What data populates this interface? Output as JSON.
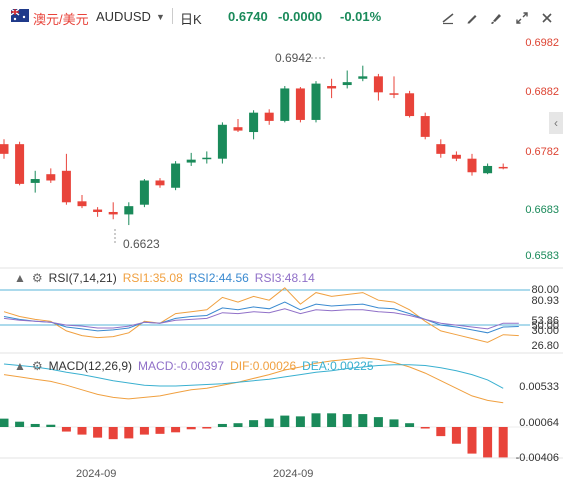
{
  "header": {
    "symbol_cn": "澳元/美元",
    "symbol_en": "AUDUSD",
    "timeframe": "日K",
    "price": "0.6740",
    "change": "-0.0000",
    "change_pct": "-0.01%",
    "up_color": "#1a8a5a",
    "down_color": "#e8433a"
  },
  "toolbar_icons": [
    "draw-line-icon",
    "pencil-icon",
    "brush-icon",
    "fullscreen-icon",
    "close-icon"
  ],
  "price_axis": [
    "0.6982",
    "0.6882",
    "0.6782",
    "0.6683",
    "0.6583"
  ],
  "annotations": {
    "high": "0.6942",
    "low": "0.6623"
  },
  "rsi": {
    "title": "RSI(7,14,21)",
    "rsi1": "RSI1:35.08",
    "rsi2": "RSI2:44.56",
    "rsi3": "RSI3:48.14",
    "axis": [
      "80.00",
      "80.93",
      "53.86",
      "50.00",
      "30.00",
      "26.80"
    ],
    "colors": {
      "rsi1": "#f0a040",
      "rsi2": "#3a8ad0",
      "rsi3": "#9070c8"
    }
  },
  "macd": {
    "title": "MACD(12,26,9)",
    "macd": "MACD:-0.00397",
    "dif": "DIF:0.00026",
    "dea": "DEA:0.00225",
    "axis": [
      "0.00533",
      "0.00064",
      "-0.00406"
    ],
    "colors": {
      "dif": "#f0a040",
      "dea": "#3ab0d0"
    }
  },
  "x_axis": [
    "2024-09",
    "2024-09"
  ],
  "chart_data": {
    "type": "candlestick",
    "ylim": [
      0.6555,
      0.7005
    ],
    "candles": [
      {
        "o": 0.679,
        "c": 0.677,
        "h": 0.68,
        "l": 0.676
      },
      {
        "o": 0.679,
        "c": 0.6708,
        "h": 0.6795,
        "l": 0.6705
      },
      {
        "o": 0.671,
        "c": 0.6718,
        "h": 0.6735,
        "l": 0.669
      },
      {
        "o": 0.6728,
        "c": 0.6715,
        "h": 0.674,
        "l": 0.671
      },
      {
        "o": 0.6735,
        "c": 0.667,
        "h": 0.677,
        "l": 0.6665
      },
      {
        "o": 0.6672,
        "c": 0.6662,
        "h": 0.6685,
        "l": 0.6658
      },
      {
        "o": 0.6655,
        "c": 0.665,
        "h": 0.666,
        "l": 0.664
      },
      {
        "o": 0.665,
        "c": 0.6645,
        "h": 0.667,
        "l": 0.6635
      },
      {
        "o": 0.6645,
        "c": 0.6662,
        "h": 0.667,
        "l": 0.6623
      },
      {
        "o": 0.6665,
        "c": 0.6715,
        "h": 0.6718,
        "l": 0.666
      },
      {
        "o": 0.6715,
        "c": 0.6705,
        "h": 0.672,
        "l": 0.67
      },
      {
        "o": 0.67,
        "c": 0.675,
        "h": 0.6755,
        "l": 0.6695
      },
      {
        "o": 0.6752,
        "c": 0.6758,
        "h": 0.6772,
        "l": 0.6745
      },
      {
        "o": 0.676,
        "c": 0.6762,
        "h": 0.6775,
        "l": 0.675
      },
      {
        "o": 0.676,
        "c": 0.683,
        "h": 0.6835,
        "l": 0.675
      },
      {
        "o": 0.6825,
        "c": 0.6818,
        "h": 0.6842,
        "l": 0.6815
      },
      {
        "o": 0.6815,
        "c": 0.6855,
        "h": 0.686,
        "l": 0.68
      },
      {
        "o": 0.6855,
        "c": 0.6838,
        "h": 0.6862,
        "l": 0.683
      },
      {
        "o": 0.6838,
        "c": 0.6905,
        "h": 0.691,
        "l": 0.6835
      },
      {
        "o": 0.6905,
        "c": 0.684,
        "h": 0.6908,
        "l": 0.6835
      },
      {
        "o": 0.684,
        "c": 0.6915,
        "h": 0.692,
        "l": 0.6835
      },
      {
        "o": 0.691,
        "c": 0.6905,
        "h": 0.6925,
        "l": 0.6885
      },
      {
        "o": 0.6912,
        "c": 0.6918,
        "h": 0.6942,
        "l": 0.6905
      },
      {
        "o": 0.6925,
        "c": 0.693,
        "h": 0.6952,
        "l": 0.692
      },
      {
        "o": 0.693,
        "c": 0.6897,
        "h": 0.6935,
        "l": 0.688
      },
      {
        "o": 0.6895,
        "c": 0.6893,
        "h": 0.693,
        "l": 0.6885
      },
      {
        "o": 0.6895,
        "c": 0.6848,
        "h": 0.69,
        "l": 0.6845
      },
      {
        "o": 0.6848,
        "c": 0.6805,
        "h": 0.6855,
        "l": 0.68
      },
      {
        "o": 0.679,
        "c": 0.677,
        "h": 0.68,
        "l": 0.6762
      },
      {
        "o": 0.6768,
        "c": 0.676,
        "h": 0.6775,
        "l": 0.6755
      },
      {
        "o": 0.676,
        "c": 0.6732,
        "h": 0.677,
        "l": 0.6725
      },
      {
        "o": 0.673,
        "c": 0.6745,
        "h": 0.675,
        "l": 0.6728
      },
      {
        "o": 0.6743,
        "c": 0.6741,
        "h": 0.675,
        "l": 0.6738
      }
    ],
    "rsi1": [
      60,
      55,
      52,
      50,
      40,
      35,
      33,
      34,
      38,
      50,
      48,
      58,
      60,
      62,
      75,
      70,
      76,
      72,
      85,
      68,
      80,
      76,
      78,
      80,
      72,
      70,
      62,
      50,
      40,
      36,
      32,
      28,
      36,
      35
    ],
    "rsi2": [
      55,
      52,
      50,
      49,
      44,
      42,
      40,
      41,
      43,
      49,
      48,
      53,
      55,
      56,
      64,
      62,
      65,
      63,
      70,
      62,
      68,
      66,
      67,
      68,
      64,
      63,
      58,
      52,
      46,
      44,
      41,
      38,
      44,
      44.6
    ],
    "rsi3": [
      53,
      51,
      50,
      49,
      46,
      45,
      43,
      43,
      45,
      49,
      48,
      51,
      52,
      53,
      59,
      58,
      60,
      59,
      63,
      58,
      62,
      61,
      62,
      62,
      60,
      59,
      56,
      52,
      48,
      46,
      44,
      42,
      48,
      48
    ],
    "histogram": [
      0.0011,
      0.0007,
      0.0004,
      0.0003,
      -0.0006,
      -0.001,
      -0.0014,
      -0.0016,
      -0.0015,
      -0.001,
      -0.0009,
      -0.0007,
      -0.0003,
      -0.0002,
      0.0004,
      0.0005,
      0.0009,
      0.0011,
      0.0015,
      0.0014,
      0.0018,
      0.0018,
      0.0017,
      0.0017,
      0.0013,
      0.001,
      0.0005,
      -0.0002,
      -0.0012,
      -0.0022,
      -0.0035,
      -0.004,
      -0.004
    ],
    "dif": [
      0.004,
      0.0037,
      0.0034,
      0.0031,
      0.0026,
      0.002,
      0.0014,
      0.001,
      0.0008,
      0.001,
      0.0012,
      0.0016,
      0.002,
      0.0022,
      0.0026,
      0.003,
      0.0035,
      0.004,
      0.0046,
      0.005,
      0.0055,
      0.0058,
      0.006,
      0.0062,
      0.006,
      0.0056,
      0.005,
      0.0042,
      0.0032,
      0.0022,
      0.0012,
      0.0006,
      0.0003
    ],
    "dea": [
      0.0054,
      0.0052,
      0.005,
      0.0047,
      0.0043,
      0.004,
      0.0036,
      0.0032,
      0.0029,
      0.0026,
      0.0025,
      0.0025,
      0.0026,
      0.0027,
      0.0028,
      0.003,
      0.0032,
      0.0034,
      0.0037,
      0.004,
      0.0043,
      0.0045,
      0.0048,
      0.005,
      0.0052,
      0.0053,
      0.0053,
      0.0052,
      0.0049,
      0.0045,
      0.004,
      0.0033,
      0.0022
    ]
  }
}
